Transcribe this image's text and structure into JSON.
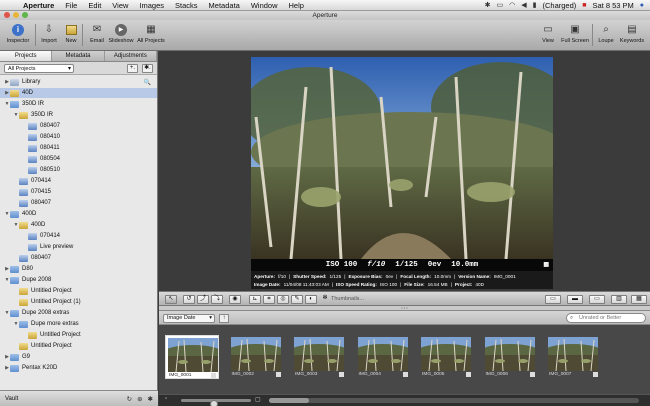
{
  "menubar": {
    "app": "Aperture",
    "items": [
      "File",
      "Edit",
      "View",
      "Images",
      "Stacks",
      "Metadata",
      "Window",
      "Help"
    ],
    "battery": "(Charged)",
    "clock": "Sat 8 53 PM"
  },
  "window": {
    "title": "Aperture"
  },
  "toolbar": {
    "inspector": "Inspector",
    "import": "Import",
    "new": "New",
    "email": "Email",
    "slideshow": "Slideshow",
    "all_projects": "All Projects",
    "view": "View",
    "full_screen": "Full Screen",
    "loupe": "Loupe",
    "keywords": "Keywords"
  },
  "sidebar": {
    "tabs": [
      "Projects",
      "Metadata",
      "Adjustments"
    ],
    "filter": "All Projects",
    "add_button": "+.",
    "action_button": "✱.",
    "tree": [
      {
        "label": "Library",
        "depth": 0,
        "tri": "▶",
        "icon": "lib",
        "mag": "🔍"
      },
      {
        "label": "40D",
        "depth": 0,
        "tri": "▶",
        "icon": "proj",
        "selected": true
      },
      {
        "label": "350D IR",
        "depth": 0,
        "tri": "▼",
        "icon": "folder"
      },
      {
        "label": "350D IR",
        "depth": 1,
        "tri": "▼",
        "icon": "proj"
      },
      {
        "label": "080407",
        "depth": 2,
        "tri": "",
        "icon": "album"
      },
      {
        "label": "080410",
        "depth": 2,
        "tri": "",
        "icon": "album"
      },
      {
        "label": "080411",
        "depth": 2,
        "tri": "",
        "icon": "album"
      },
      {
        "label": "080504",
        "depth": 2,
        "tri": "",
        "icon": "album"
      },
      {
        "label": "080510",
        "depth": 2,
        "tri": "",
        "icon": "album"
      },
      {
        "label": "070414",
        "depth": 1,
        "tri": "",
        "icon": "album"
      },
      {
        "label": "070415",
        "depth": 1,
        "tri": "",
        "icon": "album"
      },
      {
        "label": "080407",
        "depth": 1,
        "tri": "",
        "icon": "album"
      },
      {
        "label": "400D",
        "depth": 0,
        "tri": "▼",
        "icon": "folder"
      },
      {
        "label": "400D",
        "depth": 1,
        "tri": "▼",
        "icon": "proj"
      },
      {
        "label": "070414",
        "depth": 2,
        "tri": "",
        "icon": "album"
      },
      {
        "label": "Live preview",
        "depth": 2,
        "tri": "",
        "icon": "album"
      },
      {
        "label": "080407",
        "depth": 1,
        "tri": "",
        "icon": "album"
      },
      {
        "label": "D80",
        "depth": 0,
        "tri": "▶",
        "icon": "folder"
      },
      {
        "label": "Dupe 2008",
        "depth": 0,
        "tri": "▼",
        "icon": "folder"
      },
      {
        "label": "Untitled Project",
        "depth": 1,
        "tri": "",
        "icon": "proj"
      },
      {
        "label": "Untitled Project (1)",
        "depth": 1,
        "tri": "",
        "icon": "proj"
      },
      {
        "label": "Dupe 2008 extras",
        "depth": 0,
        "tri": "▼",
        "icon": "folder"
      },
      {
        "label": "Dupe more extras",
        "depth": 1,
        "tri": "▼",
        "icon": "folder"
      },
      {
        "label": "Untitled Project",
        "depth": 2,
        "tri": "",
        "icon": "proj"
      },
      {
        "label": "Untitled Project",
        "depth": 1,
        "tri": "",
        "icon": "proj"
      },
      {
        "label": "G9",
        "depth": 0,
        "tri": "▶",
        "icon": "folder"
      },
      {
        "label": "Pentax K20D",
        "depth": 0,
        "tri": "▶",
        "icon": "folder"
      }
    ],
    "vault": "Vault"
  },
  "viewer": {
    "hud": {
      "iso": "ISO 100",
      "fstop": "f/10",
      "shutter": "1/125",
      "ev": "0ev",
      "focal": "10.0mm"
    },
    "meta": {
      "line1": [
        {
          "k": "Aperture:",
          "v": "f/10"
        },
        {
          "k": "Shutter Speed:",
          "v": "1/125"
        },
        {
          "k": "Exposure Bias:",
          "v": "0ev"
        },
        {
          "k": "Focal Length:",
          "v": "10.0mm"
        },
        {
          "k": "Version Name:",
          "v": "IMG_0001"
        }
      ],
      "line2": [
        {
          "k": "Image Date:",
          "v": "11/04/08 11:43:03 AM"
        },
        {
          "k": "ISO Speed Rating:",
          "v": "ISO 100"
        },
        {
          "k": "File Size:",
          "v": "16.54 MB"
        },
        {
          "k": "Project:",
          "v": "40D"
        }
      ]
    }
  },
  "controls": {
    "thumbnails_label": "Thumbnails..."
  },
  "browser": {
    "sort": "Image Date",
    "sort_dir": "↑",
    "filter_placeholder": "Unrated or Better",
    "thumbs": [
      "IMG_0001",
      "IMG_0002",
      "IMG_0003",
      "IMG_0004",
      "IMG_0005",
      "IMG_0006",
      "IMG_0007"
    ]
  }
}
